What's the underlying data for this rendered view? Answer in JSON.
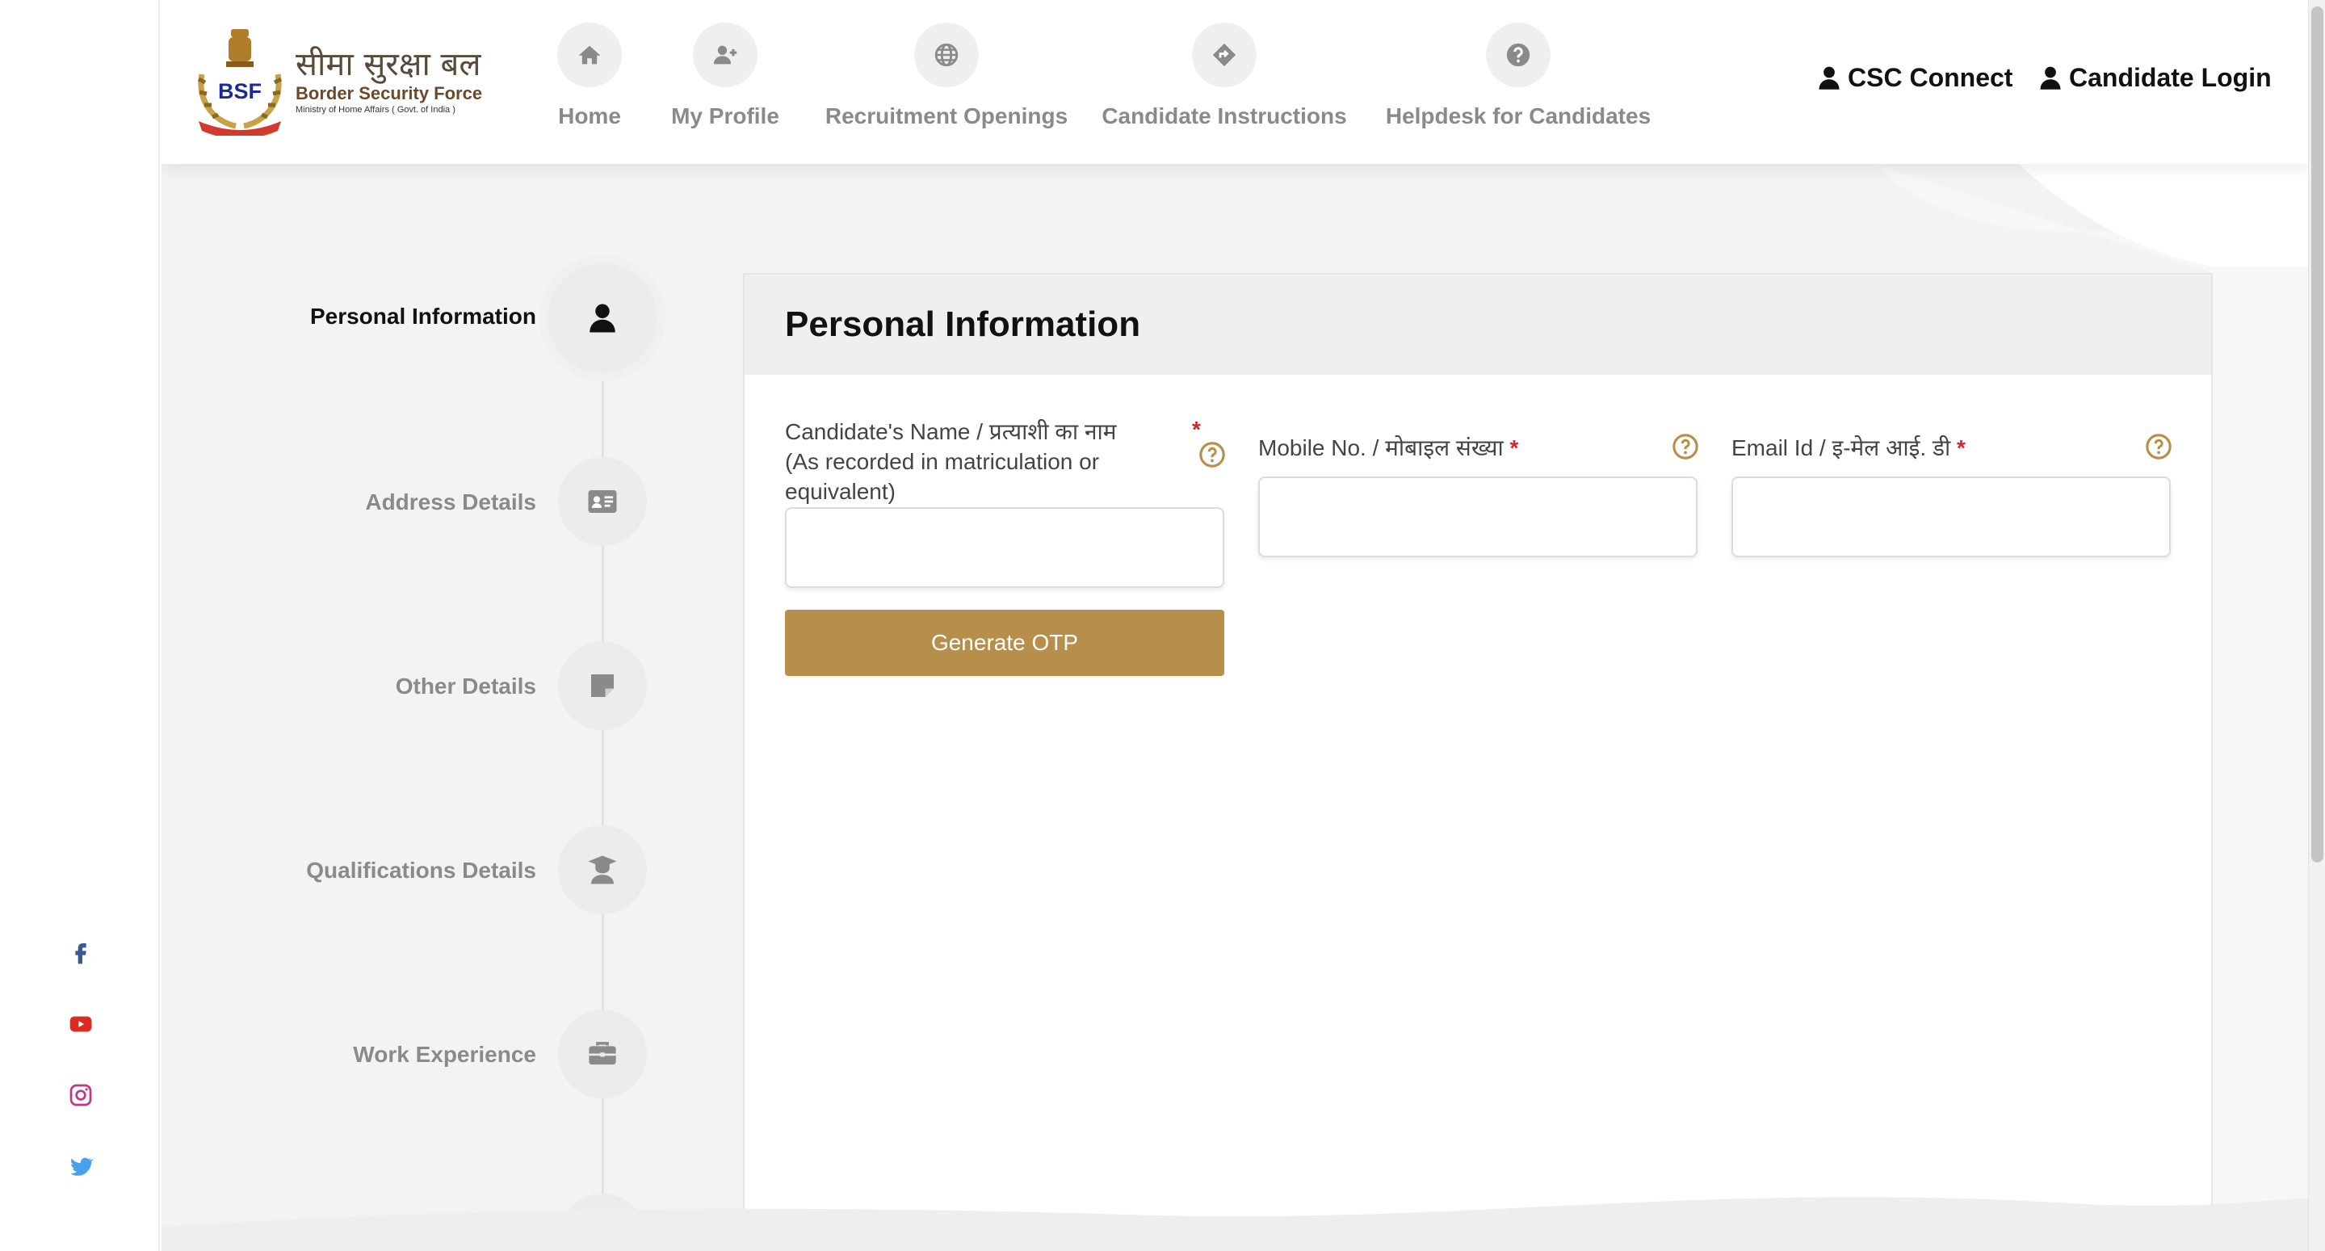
{
  "colors": {
    "accent": "#b78f4a",
    "required": "#d0282e",
    "nav_label": "#8a8a8a"
  },
  "logo": {
    "hindi": "सीमा सुरक्षा बल",
    "english": "Border Security Force",
    "ministry": "Ministry of Home Affairs ( Govt. of India )",
    "badge": "BSF"
  },
  "nav": {
    "items": [
      {
        "label": "Home",
        "icon": "home-icon"
      },
      {
        "label": "My Profile",
        "icon": "add-user-icon"
      },
      {
        "label": "Recruitment Openings",
        "icon": "globe-icon"
      },
      {
        "label": "Candidate Instructions",
        "icon": "directions-icon"
      },
      {
        "label": "Helpdesk for Candidates",
        "icon": "question-icon"
      }
    ],
    "csc_connect": "CSC Connect",
    "candidate_login": "Candidate Login"
  },
  "social": [
    "facebook-icon",
    "youtube-icon",
    "instagram-icon",
    "twitter-icon"
  ],
  "steps": [
    {
      "label": "Personal Information",
      "icon": "user-icon",
      "active": true
    },
    {
      "label": "Address Details",
      "icon": "id-card-icon",
      "active": false
    },
    {
      "label": "Other Details",
      "icon": "note-icon",
      "active": false
    },
    {
      "label": "Qualifications Details",
      "icon": "graduate-icon",
      "active": false
    },
    {
      "label": "Work Experience",
      "icon": "briefcase-icon",
      "active": false
    }
  ],
  "form": {
    "title": "Personal Information",
    "name_label_line1": "Candidate's Name / प्रत्याशी का नाम",
    "name_label_line2": "(As recorded in matriculation or",
    "name_label_line3": "equivalent)",
    "name_value": "",
    "mobile_label": "Mobile No. / मोबाइल संख्या",
    "mobile_value": "",
    "email_label": "Email Id / इ-मेल आई. डी",
    "email_value": "",
    "required_mark": "*",
    "otp_button": "Generate OTP"
  }
}
